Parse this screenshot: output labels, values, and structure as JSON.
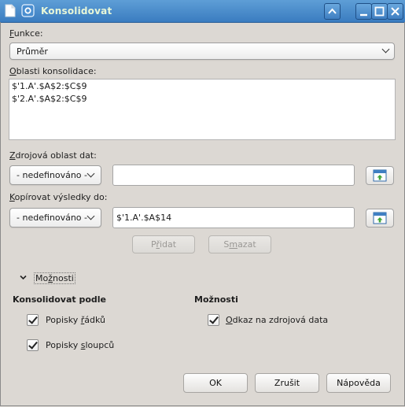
{
  "window": {
    "title": "Konsolidovat",
    "controls": {
      "rollup": "^",
      "minimize": "_",
      "maximize": "□",
      "close": "✕"
    }
  },
  "function": {
    "label": "Funkce:",
    "label_u": "F",
    "label_rest": "unkce:",
    "selected": "Průměr"
  },
  "ranges": {
    "label_u": "O",
    "label_rest": "blasti konsolidace:",
    "items": [
      "$'1.A'.$A$2:$C$9",
      "$'2.A'.$A$2:$C$9"
    ]
  },
  "source": {
    "label_u": "Z",
    "label_rest": "drojová oblast dat:",
    "combo": "- nedefinováno -",
    "value": ""
  },
  "copyto": {
    "label_u": "K",
    "label_rest": "opírovat výsledky do:",
    "combo": "- nedefinováno -",
    "value": "$'1.A'.$A$14"
  },
  "buttons": {
    "add_pre": "P",
    "add_u": "ř",
    "add_post": "idat",
    "delete_pre": "S",
    "delete_u": "m",
    "delete_post": "azat",
    "ok": "OK",
    "cancel": "Zrušit",
    "help": "Nápověda"
  },
  "expander": {
    "label_pre": "Mo",
    "label_u": "ž",
    "label_post": "nosti"
  },
  "consolidate_by": {
    "heading": "Konsolidovat podle",
    "rows": {
      "pre": "Popisky ",
      "u": "ř",
      "post": "ádků",
      "checked": true
    },
    "cols": {
      "pre": "Popisky ",
      "u": "s",
      "post": "loupců",
      "checked": true
    }
  },
  "options": {
    "heading": "Možnosti",
    "link": {
      "pre": "",
      "u": "O",
      "post": "dkaz na zdrojová data",
      "checked": true
    }
  }
}
